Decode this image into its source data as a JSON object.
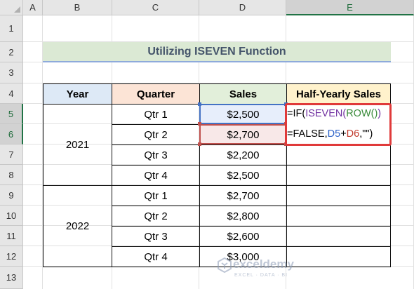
{
  "columns": [
    "A",
    "B",
    "C",
    "D",
    "E"
  ],
  "rows": [
    "1",
    "2",
    "3",
    "4",
    "5",
    "6",
    "7",
    "8",
    "9",
    "10",
    "11",
    "12",
    "13"
  ],
  "title": "Utilizing ISEVEN Function",
  "headers": {
    "year": "Year",
    "quarter": "Quarter",
    "sales": "Sales",
    "half": "Half-Yearly Sales"
  },
  "years": [
    "2021",
    "2022"
  ],
  "quarters": [
    "Qtr 1",
    "Qtr 2",
    "Qtr 3",
    "Qtr 4",
    "Qtr 1",
    "Qtr 2",
    "Qtr 3",
    "Qtr 4"
  ],
  "sales": [
    "$2,500",
    "$2,700",
    "$2,200",
    "$2,500",
    "$2,700",
    "$2,800",
    "$2,600",
    "$3,000"
  ],
  "formula": {
    "line1_prefix": "=IF(",
    "line1_iseven": "ISEVEN(",
    "line1_row": "ROW()",
    "line1_close": ")",
    "line2_prefix": "=FALSE,",
    "line2_d5": "D5",
    "line2_plus": "+",
    "line2_d6": "D6",
    "line2_suffix": ",\"\")"
  },
  "watermark": {
    "name": "exceldemy",
    "tagline": "EXCEL · DATA · BI"
  },
  "colors": {
    "header_year": "#dde9f6",
    "header_quarter": "#fce4d6",
    "header_sales": "#e2efda",
    "header_half": "#fff2cc",
    "highlight_box": "#e03a3a"
  }
}
